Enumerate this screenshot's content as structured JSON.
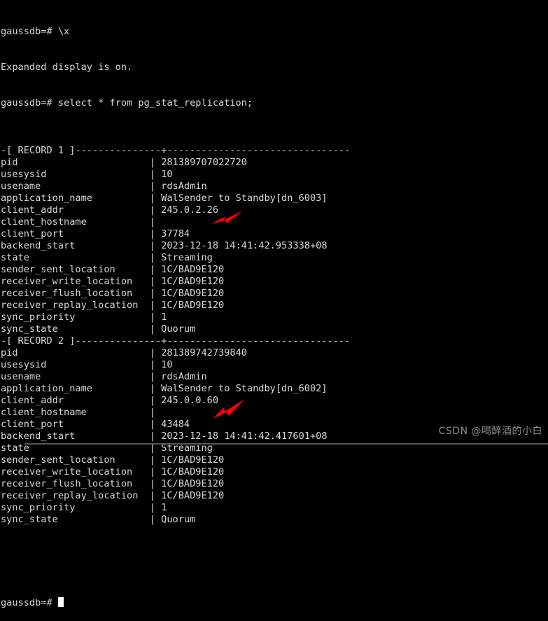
{
  "terminal": {
    "prompt": "gaussdb=#",
    "colors": {
      "background": "#000000",
      "foreground": "#d8d8d8",
      "cursor": "#ffffff",
      "annotation_arrow": "#ff0000",
      "watermark": "#8b8b8b",
      "rule": "#55565a"
    },
    "command_one": "gaussdb=# \\x",
    "command_one_output": "Expanded display is on.",
    "command_two": "gaussdb=# select * from pg_stat_replication;",
    "final_prompt": "gaussdb=# ",
    "key_column_width": 26,
    "records": [
      {
        "separator": "-[ RECORD 1 ]---------------+--------------------------------",
        "rows": [
          {
            "key": "pid",
            "value": "281389707022720"
          },
          {
            "key": "usesysid",
            "value": "10"
          },
          {
            "key": "usename",
            "value": "rdsAdmin"
          },
          {
            "key": "application_name",
            "value": "WalSender to Standby[dn_6003]"
          },
          {
            "key": "client_addr",
            "value": "245.0.2.26"
          },
          {
            "key": "client_hostname",
            "value": ""
          },
          {
            "key": "client_port",
            "value": "37784"
          },
          {
            "key": "backend_start",
            "value": "2023-12-18 14:41:42.953338+08"
          },
          {
            "key": "state",
            "value": "Streaming"
          },
          {
            "key": "sender_sent_location",
            "value": "1C/BAD9E120"
          },
          {
            "key": "receiver_write_location",
            "value": "1C/BAD9E120"
          },
          {
            "key": "receiver_flush_location",
            "value": "1C/BAD9E120"
          },
          {
            "key": "receiver_replay_location",
            "value": "1C/BAD9E120"
          },
          {
            "key": "sync_priority",
            "value": "1"
          },
          {
            "key": "sync_state",
            "value": "Quorum"
          }
        ]
      },
      {
        "separator": "-[ RECORD 2 ]---------------+--------------------------------",
        "rows": [
          {
            "key": "pid",
            "value": "281389742739840"
          },
          {
            "key": "usesysid",
            "value": "10"
          },
          {
            "key": "usename",
            "value": "rdsAdmin"
          },
          {
            "key": "application_name",
            "value": "WalSender to Standby[dn_6002]"
          },
          {
            "key": "client_addr",
            "value": "245.0.0.60"
          },
          {
            "key": "client_hostname",
            "value": ""
          },
          {
            "key": "client_port",
            "value": "43484"
          },
          {
            "key": "backend_start",
            "value": "2023-12-18 14:41:42.417601+08"
          },
          {
            "key": "state",
            "value": "Streaming"
          },
          {
            "key": "sender_sent_location",
            "value": "1C/BAD9E120"
          },
          {
            "key": "receiver_write_location",
            "value": "1C/BAD9E120"
          },
          {
            "key": "receiver_flush_location",
            "value": "1C/BAD9E120"
          },
          {
            "key": "receiver_replay_location",
            "value": "1C/BAD9E120"
          },
          {
            "key": "sync_priority",
            "value": "1"
          },
          {
            "key": "sync_state",
            "value": "Quorum"
          }
        ]
      }
    ],
    "annotations": [
      {
        "name": "arrow-pointing-at-sync-state-record-1",
        "target": "Quorum"
      },
      {
        "name": "arrow-pointing-at-sync-state-record-2",
        "target": "Quorum"
      }
    ]
  },
  "watermark": {
    "text": "CSDN @喝醉酒的小白"
  }
}
